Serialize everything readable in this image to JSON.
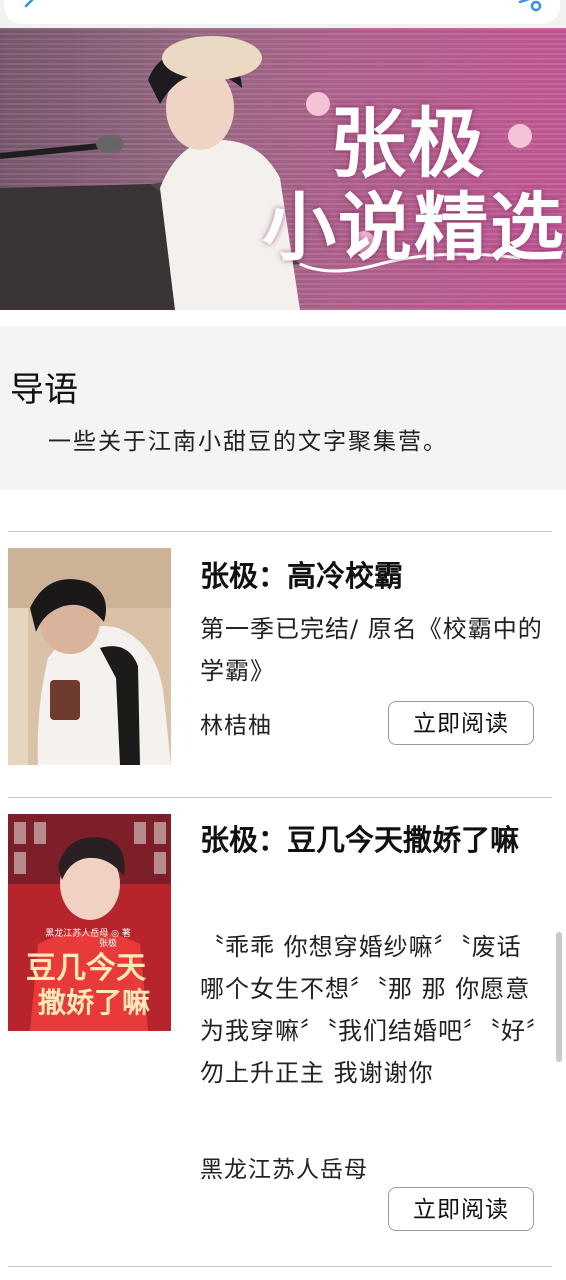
{
  "banner": {
    "title_line1": "张极",
    "title_line2": "小说精选"
  },
  "intro": {
    "title": "导语",
    "text": "一些关于江南小甜豆的文字聚集营。"
  },
  "books": [
    {
      "title": "张极：高冷校霸",
      "description": "第一季已完结/ 原名《校霸中的学霸》",
      "author": "林桔柚",
      "button": "立即阅读"
    },
    {
      "title": "张极：豆几今天撒娇了嘛",
      "description": "〝乖乖 你想穿婚纱嘛〞〝废话 哪个女生不想〞〝那 那 你愿意为我穿嘛〞〝我们结婚吧〞〝好〞勿上升正主 我谢谢你",
      "author": "黑龙江苏人岳母",
      "button": "立即阅读",
      "cover_caption_top": "黑龙江苏人岳母 ◎ 著",
      "cover_caption_name": "张极",
      "cover_title_1": "豆几今天",
      "cover_title_2": "撒娇了嘛"
    }
  ],
  "icons": {
    "back": "chevron-left-icon",
    "share": "share-icon"
  },
  "colors": {
    "accent": "#3a8ee6",
    "banner": "#c65b98"
  }
}
